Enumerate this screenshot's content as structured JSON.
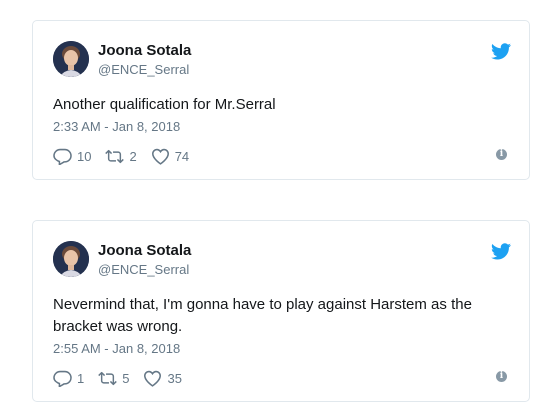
{
  "tweets": [
    {
      "name": "Joona Sotala",
      "handle": "@ENCE_Serral",
      "text": "Another qualification for Mr.Serral",
      "time": "2:33 AM - Jan 8, 2018",
      "replies": "10",
      "retweets": "2",
      "likes": "74"
    },
    {
      "name": "Joona Sotala",
      "handle": "@ENCE_Serral",
      "text": "Nevermind that, I'm gonna have to play against Harstem as the bracket was wrong.",
      "time": "2:55 AM - Jan 8, 2018",
      "replies": "1",
      "retweets": "5",
      "likes": "35"
    }
  ],
  "info_glyph": "i",
  "colors": {
    "twitter_blue": "#1da1f2",
    "text": "#14171a",
    "secondary": "#657786",
    "border": "#e1e8ed"
  }
}
